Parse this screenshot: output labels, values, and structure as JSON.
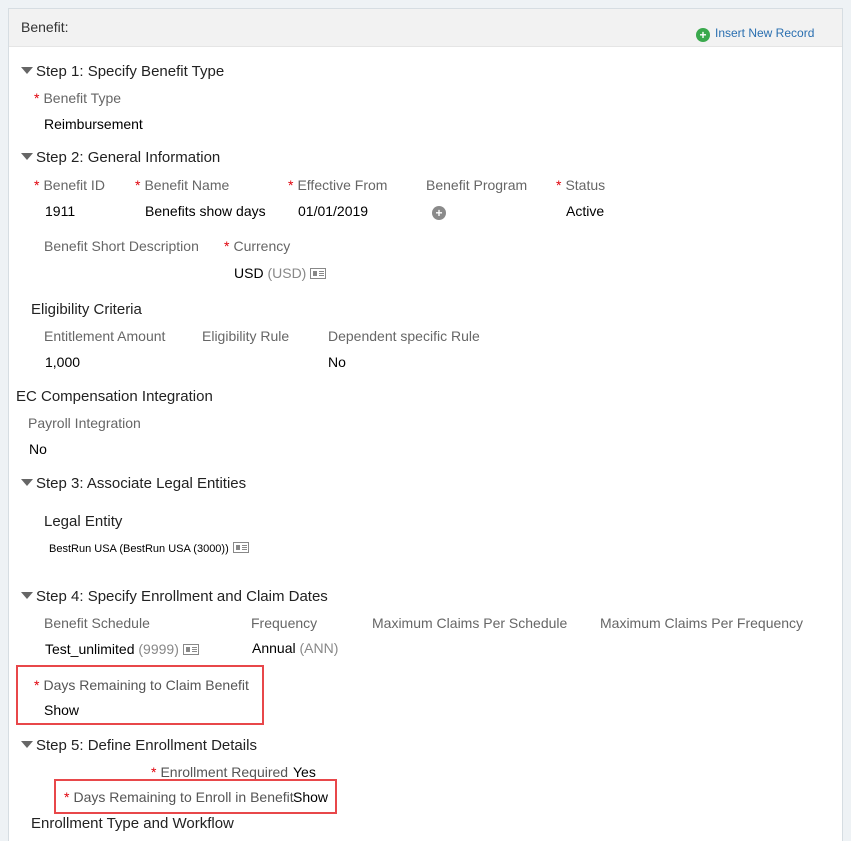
{
  "header": {
    "title": "Benefit:",
    "insert_label": "Insert New Record"
  },
  "step1": {
    "title": "Step 1: Specify Benefit Type",
    "type_label": "Benefit Type",
    "type_value": "Reimbursement"
  },
  "step2": {
    "title": "Step 2: General Information",
    "id_label": "Benefit ID",
    "id_value": "1911",
    "name_label": "Benefit Name",
    "name_value": "Benefits show days",
    "from_label": "Effective From",
    "from_value": "01/01/2019",
    "program_label": "Benefit Program",
    "status_label": "Status",
    "status_value": "Active",
    "short_desc_label": "Benefit Short Description",
    "currency_label": "Currency",
    "currency_value": "USD",
    "currency_code": "(USD)"
  },
  "eligibility": {
    "title": "Eligibility Criteria",
    "amount_label": "Entitlement Amount",
    "amount_value": "1,000",
    "rule_label": "Eligibility Rule",
    "dependent_label": "Dependent specific Rule",
    "dependent_value": "No"
  },
  "ec": {
    "title": "EC Compensation Integration",
    "payroll_label": "Payroll Integration",
    "payroll_value": "No"
  },
  "step3": {
    "title": "Step 3: Associate Legal Entities",
    "entity_title": "Legal Entity",
    "entity_value": "BestRun USA (BestRun USA (3000))"
  },
  "step4": {
    "title": "Step 4: Specify Enrollment and Claim Dates",
    "schedule_label": "Benefit Schedule",
    "schedule_value": "Test_unlimited",
    "schedule_code": "(9999)",
    "frequency_label": "Frequency",
    "frequency_value": "Annual",
    "frequency_code": "(ANN)",
    "max_schedule_label": "Maximum Claims Per Schedule",
    "max_frequency_label": "Maximum Claims Per Frequency",
    "days_claim_label": "Days Remaining to Claim Benefit",
    "days_claim_value": "Show"
  },
  "step5": {
    "title": "Step 5: Define Enrollment Details",
    "enroll_req_label": "Enrollment Required",
    "enroll_req_value": "Yes",
    "days_enroll_label": "Days Remaining to Enroll in Benefit",
    "days_enroll_value": "Show"
  },
  "enrollment": {
    "title": "Enrollment Type and Workflow"
  },
  "colors": {
    "required": "#e0000a",
    "highlight": "#e8474a",
    "link": "#2a6fb0"
  }
}
